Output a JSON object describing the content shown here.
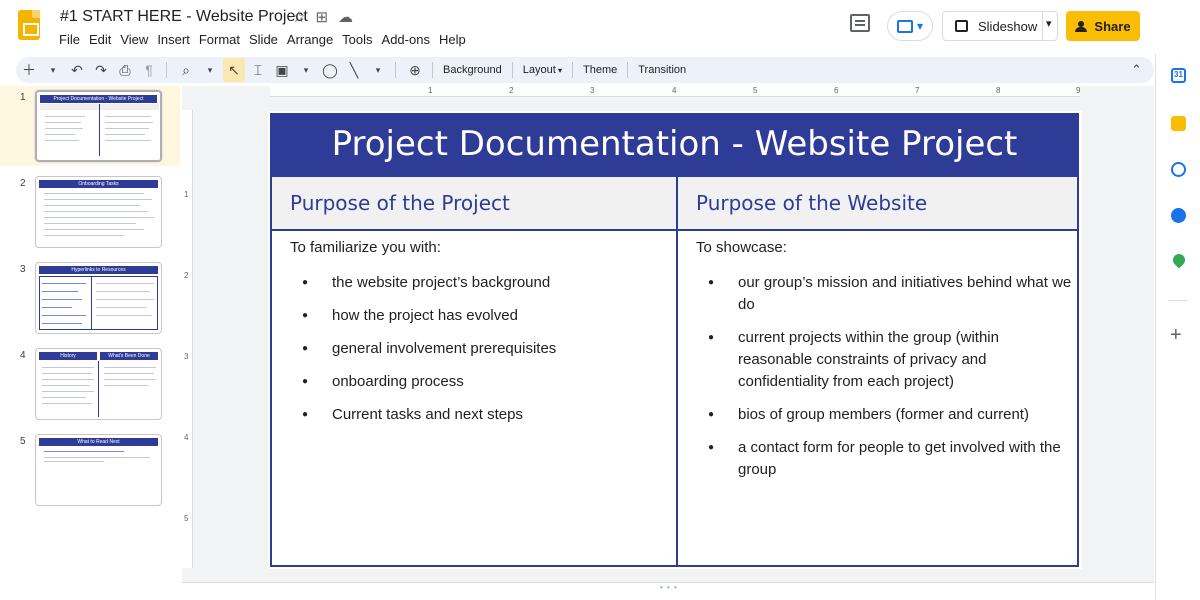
{
  "app": {
    "doc_title": "#1 START HERE - Website Project",
    "menu": [
      "File",
      "Edit",
      "View",
      "Insert",
      "Format",
      "Slide",
      "Arrange",
      "Tools",
      "Add-ons",
      "Help"
    ],
    "slideshow_label": "Slideshow",
    "share_label": "Share"
  },
  "toolbar": {
    "background_label": "Background",
    "layout_label": "Layout",
    "theme_label": "Theme",
    "transition_label": "Transition"
  },
  "rulers": {
    "horizontal": [
      "1",
      "2",
      "3",
      "4",
      "5",
      "6",
      "7",
      "8",
      "9"
    ],
    "vertical": [
      "1",
      "2",
      "3",
      "4",
      "5"
    ]
  },
  "filmstrip": [
    {
      "number": "1",
      "title": "Project Documentation - Website Project",
      "selected": true
    },
    {
      "number": "2",
      "title": "Onboarding Tasks",
      "selected": false
    },
    {
      "number": "3",
      "title": "Hyperlinks to Resources",
      "selected": false
    },
    {
      "number": "4",
      "title": "History",
      "title2": "What's Been Done",
      "selected": false
    },
    {
      "number": "5",
      "title": "What to Read Next",
      "selected": false
    }
  ],
  "slide": {
    "title": "Project Documentation - Website Project",
    "left": {
      "heading": "Purpose of the Project",
      "intro": "To familiarize you with:",
      "bullets": [
        "the website project’s background",
        "how the project has evolved",
        "general involvement prerequisites",
        "onboarding process",
        "Current tasks and next steps"
      ]
    },
    "right": {
      "heading": "Purpose of the Website",
      "intro": "To showcase:",
      "bullets": [
        "our group’s mission and initiatives behind what we do",
        "current projects within the group (within reasonable constraints of privacy and confidentiality from each project)",
        "bios of group members (former and current)",
        "a contact form for people to get involved with the group"
      ]
    }
  },
  "colors": {
    "brand_navy": "#2e3b97",
    "share_yellow": "#fbbc04",
    "selected_thumb_bg": "#fef7e0"
  }
}
